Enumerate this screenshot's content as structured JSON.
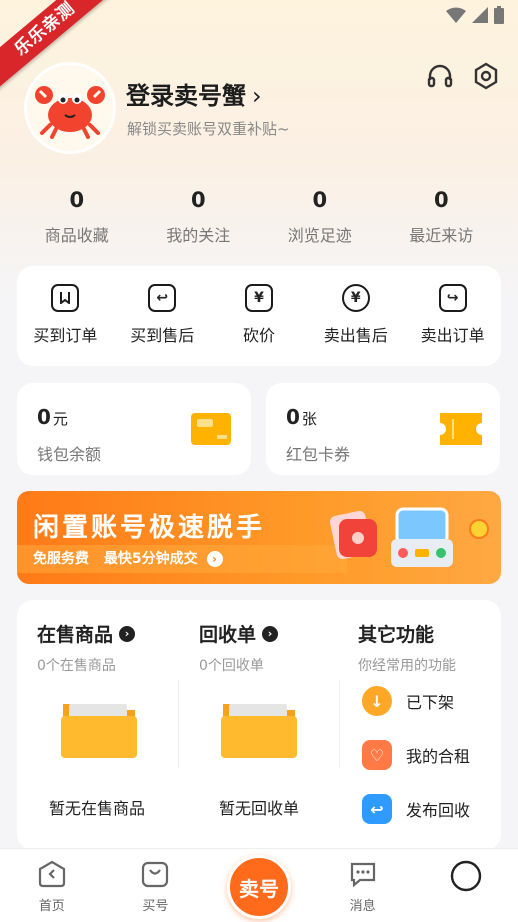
{
  "ribbon": "乐乐亲测",
  "profile": {
    "login_text": "登录卖号蟹",
    "subtitle": "解锁买卖账号双重补贴~"
  },
  "stats": [
    {
      "value": "0",
      "label": "商品收藏"
    },
    {
      "value": "0",
      "label": "我的关注"
    },
    {
      "value": "0",
      "label": "浏览足迹"
    },
    {
      "value": "0",
      "label": "最近来访"
    }
  ],
  "orders": [
    {
      "label": "买到订单",
      "icon": "bookmark-icon",
      "glyph": ""
    },
    {
      "label": "买到售后",
      "icon": "return-icon",
      "glyph": "↩"
    },
    {
      "label": "砍价",
      "icon": "yen-tag-icon",
      "glyph": "¥"
    },
    {
      "label": "卖出售后",
      "icon": "yen-circle-icon",
      "glyph": "¥"
    },
    {
      "label": "卖出订单",
      "icon": "forward-icon",
      "glyph": "↪"
    }
  ],
  "wallet": {
    "balance_value": "0",
    "balance_unit": "元",
    "balance_label": "钱包余额",
    "coupon_value": "0",
    "coupon_unit": "张",
    "coupon_label": "红包卡券"
  },
  "banner": {
    "title": "闲置账号极速脱手",
    "sub1": "免服务费",
    "sub2": "最快5分钟成交"
  },
  "on_sale": {
    "title": "在售商品",
    "sub": "0个在售商品",
    "empty": "暂无在售商品"
  },
  "recycle": {
    "title": "回收单",
    "sub": "0个回收单",
    "empty": "暂无回收单"
  },
  "other": {
    "title": "其它功能",
    "sub": "你经常用的功能",
    "items": [
      {
        "label": "已下架",
        "icon": "download-icon",
        "color": "#ffa726"
      },
      {
        "label": "我的合租",
        "icon": "heart-link-icon",
        "color": "#ff7a45"
      },
      {
        "label": "发布回收",
        "icon": "return-square-icon",
        "color": "#2f9bff"
      }
    ]
  },
  "tabbar": {
    "home": "首页",
    "buy": "买号",
    "sell": "卖号",
    "messages": "消息"
  },
  "colors": {
    "accent": "#ff6b1a",
    "ribbon": "#d9262a"
  }
}
